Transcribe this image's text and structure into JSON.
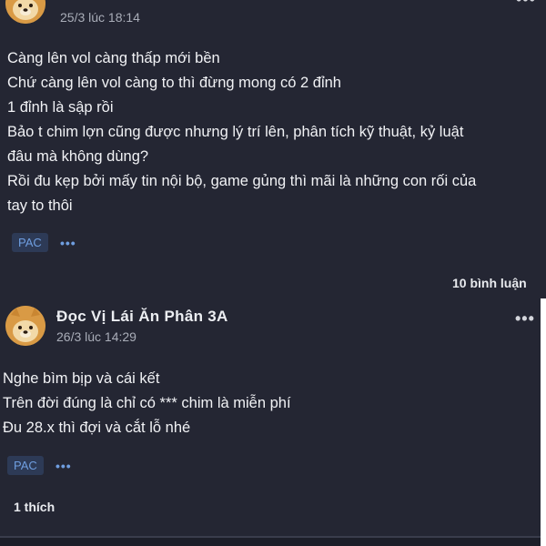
{
  "post_top": {
    "author_name": "",
    "timestamp": "25/3 lúc 18:14",
    "lines": [
      "Càng lên vol càng thấp mới bền",
      "Chứ càng lên vol càng to thì đừng mong có 2 đỉnh",
      "1 đỉnh là sập rồi",
      "Bảo t chim lợn cũng được nhưng lý trí lên, phân tích kỹ thuật, kỷ luật",
      "đâu mà không dùng?",
      "Rồi đu kẹp bởi mấy tin nội bộ, game gủng thì mãi là những con rối của",
      "tay to thôi"
    ],
    "tag": "PAC",
    "tag_more": "•••",
    "comments": "10 bình luận"
  },
  "post_bottom": {
    "author_name": "Đọc Vị Lái Ăn Phân 3A",
    "timestamp": "26/3 lúc 14:29",
    "more": "•••",
    "lines": [
      "Nghe bìm bịp và cái kết",
      "Trên đời đúng là chỉ có *** chim là miễn phí",
      "Đu 28.x thì đợi và cắt lỗ nhé"
    ],
    "tag": "PAC",
    "tag_more": "•••",
    "likes": "1 thích"
  },
  "colors": {
    "card_bg": "#242633",
    "text": "#f1f2f5",
    "muted": "#a9adb8",
    "tag_bg": "#2d3a56",
    "tag_text": "#6f9ee0"
  },
  "icons": {
    "avatar": "shiba-doge-avatar",
    "more": "more-dots-icon"
  }
}
